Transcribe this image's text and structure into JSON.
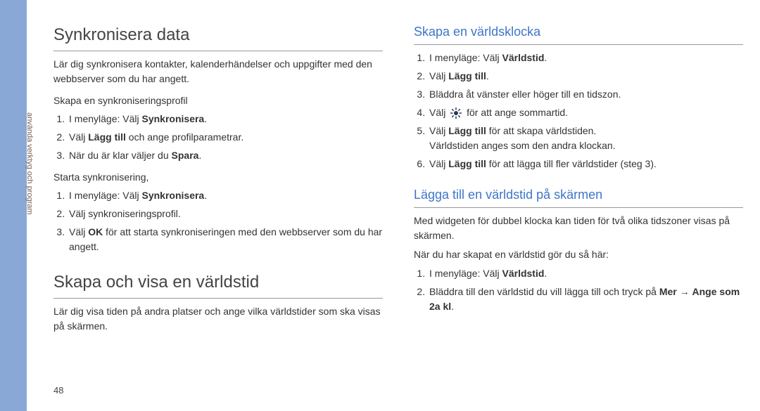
{
  "page_number": "48",
  "side_label": "använda verktyg och program",
  "col1": {
    "h1a": "Synkronisera data",
    "intro1": "Lär dig synkronisera kontakter, kalenderhändelser och uppgifter med den webbserver som du har angett.",
    "sub1": "Skapa en synkroniseringsprofil",
    "list1": {
      "i1a": "I menyläge: Välj ",
      "i1b": "Synkronisera",
      "i1c": ".",
      "i2a": "Välj ",
      "i2b": "Lägg till",
      "i2c": " och ange profilparametrar.",
      "i3a": "När du är klar väljer du ",
      "i3b": "Spara",
      "i3c": "."
    },
    "sub2": "Starta synkronisering,",
    "list2": {
      "i1a": "I menyläge: Välj ",
      "i1b": "Synkronisera",
      "i1c": ".",
      "i2": "Välj synkroniseringsprofil.",
      "i3a": "Välj ",
      "i3b": "OK",
      "i3c": " för att starta synkroniseringen med den webbserver som du har angett."
    },
    "h1b": "Skapa och visa en världstid",
    "intro2": "Lär dig visa tiden på andra platser och ange vilka världstider som ska visas på skärmen."
  },
  "col2": {
    "h2a": "Skapa en världsklocka",
    "list1": {
      "i1a": "I menyläge: Välj ",
      "i1b": "Världstid",
      "i1c": ".",
      "i2a": "Välj ",
      "i2b": "Lägg till",
      "i2c": ".",
      "i3": "Bläddra åt vänster eller höger till en tidszon.",
      "i4a": "Välj ",
      "i4b": " för att ange sommartid.",
      "i5a": "Välj ",
      "i5b": "Lägg till",
      "i5c": " för att skapa världstiden.",
      "i5d": "Världstiden anges som den andra klockan.",
      "i6a": "Välj ",
      "i6b": "Lägg till",
      "i6c": " för att lägga till fler världstider (steg 3)."
    },
    "h2b": "Lägga till en världstid på skärmen",
    "p1": "Med widgeten för dubbel klocka kan tiden för två olika tidszoner visas på skärmen.",
    "p2": "När du har skapat en världstid gör du så här:",
    "list2": {
      "i1a": "I menyläge: Välj ",
      "i1b": "Världstid",
      "i1c": ".",
      "i2a": "Bläddra till den världstid du vill lägga till och tryck på ",
      "i2b": "Mer",
      "i2c": " → ",
      "i2d": "Ange som 2a kl",
      "i2e": "."
    }
  }
}
